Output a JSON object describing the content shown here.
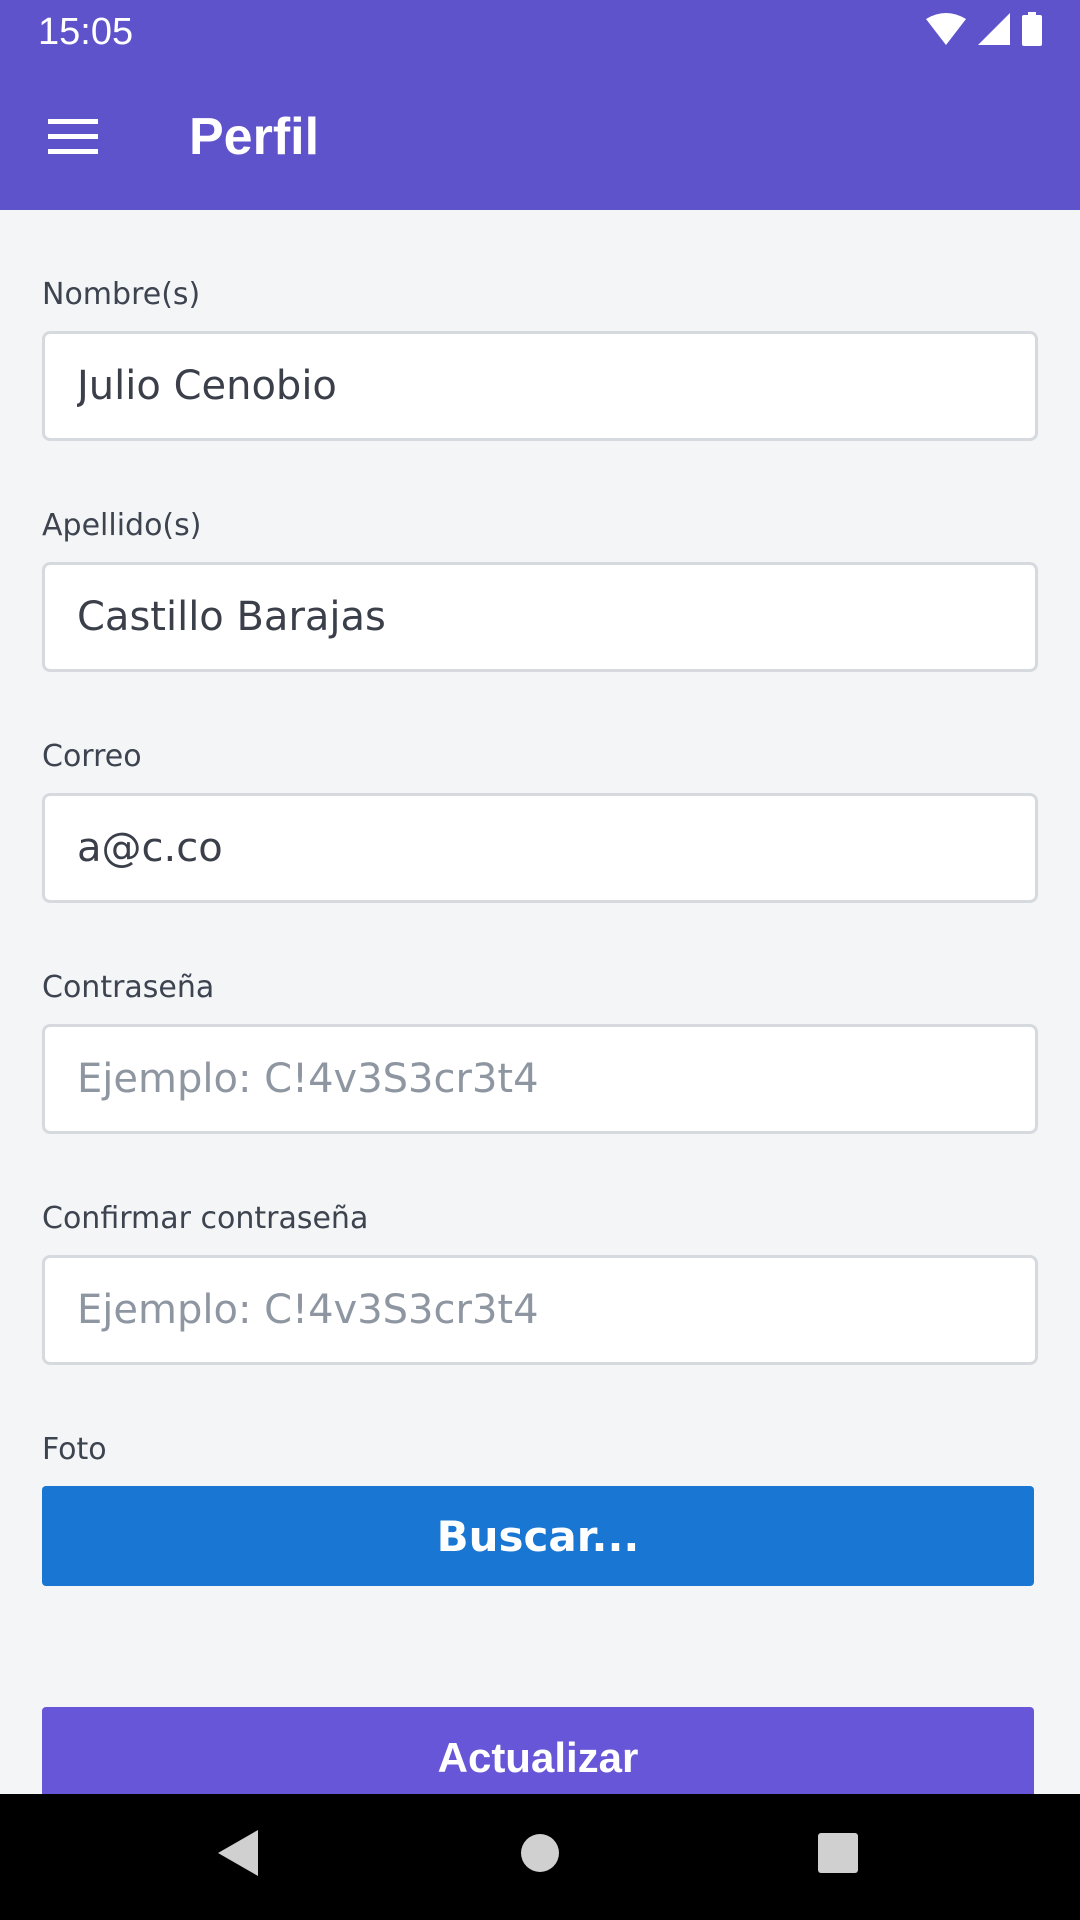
{
  "status_bar": {
    "time": "15:05",
    "icons": [
      "wifi-icon",
      "signal-icon",
      "battery-icon"
    ]
  },
  "app_bar": {
    "menu_icon": "menu-icon",
    "title": "Perfil",
    "color": "#5f53cc"
  },
  "form": {
    "nombres": {
      "label": "Nombre(s)",
      "value": "Julio Cenobio"
    },
    "apellidos": {
      "label": "Apellido(s)",
      "value": "Castillo Barajas"
    },
    "correo": {
      "label": "Correo",
      "value": "a@c.co"
    },
    "contrasena": {
      "label": "Contraseña",
      "placeholder": "Ejemplo: C!4v3S3cr3t4"
    },
    "confirmar": {
      "label": "Confirmar contraseña",
      "placeholder": "Ejemplo: C!4v3S3cr3t4"
    },
    "foto": {
      "label": "Foto",
      "button_label": "Buscar..."
    },
    "submit_label": "Actualizar"
  },
  "colors": {
    "buscar_button": "#1976d2",
    "actualizar_button": "#6757d8",
    "background": "#f4f5f7"
  },
  "nav_bar": {
    "icons": [
      "back-icon",
      "home-icon",
      "recents-icon"
    ]
  }
}
